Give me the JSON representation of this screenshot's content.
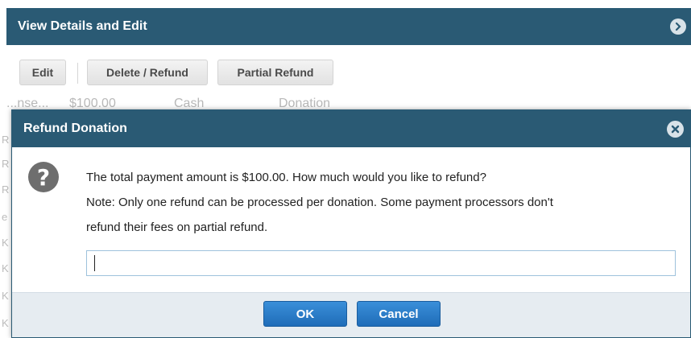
{
  "panel": {
    "title": "View Details and Edit",
    "toolbar": {
      "edit_label": "Edit",
      "delete_refund_label": "Delete / Refund",
      "partial_refund_label": "Partial Refund"
    },
    "background_row": {
      "col1": "...nse...",
      "col2": "$100.00",
      "col3": "Cash",
      "col4": "Donation"
    },
    "background_left_letters": [
      "R",
      "R",
      "R",
      "e",
      "K",
      "K",
      "K",
      "K"
    ]
  },
  "dialog": {
    "title": "Refund Donation",
    "message_line1": "The total payment amount is $100.00. How much would you like to refund?",
    "message_line2": "Note: Only one refund can be processed per donation. Some payment processors don't",
    "message_line3": "refund their fees on partial refund.",
    "input_value": "",
    "ok_label": "OK",
    "cancel_label": "Cancel"
  },
  "icons": {
    "panel_chevron": "chevron-right-circle-icon",
    "dialog_close": "close-circle-icon",
    "dialog_question": "question-circle-icon"
  },
  "colors": {
    "header_bg": "#2a5a74",
    "footer_bg": "#e6ecf1",
    "primary_button": "#2a7ac8",
    "input_border": "#9ec2dc"
  }
}
